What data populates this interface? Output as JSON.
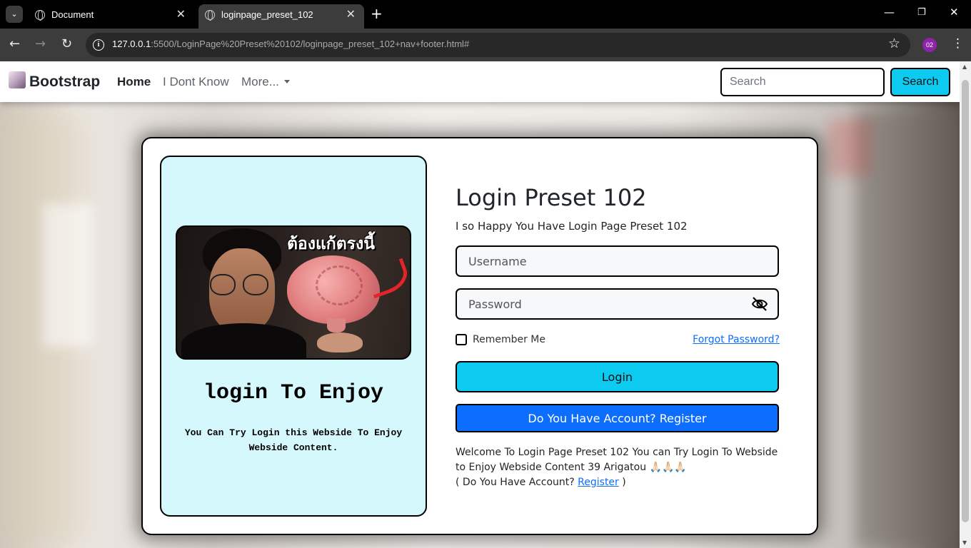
{
  "browser": {
    "tabs": [
      {
        "title": "Document"
      },
      {
        "title": "loginpage_preset_102"
      }
    ],
    "url_host": "127.0.0.1",
    "url_rest": ":5500/LoginPage%20Preset%20102/loginpage_preset_102+nav+footer.html#",
    "profile_initials": "02"
  },
  "navbar": {
    "brand": "Bootstrap",
    "links": [
      "Home",
      "I Dont Know",
      "More..."
    ],
    "search_placeholder": "Search",
    "search_button": "Search"
  },
  "left_panel": {
    "image_caption": "ต้องแก้ตรงนี้",
    "title": "login To Enjoy",
    "subtitle": "You Can Try Login this Webside To Enjoy Webside Content."
  },
  "form": {
    "title": "Login Preset 102",
    "subtitle": "I so Happy You Have Login Page Preset 102",
    "username_placeholder": "Username",
    "password_placeholder": "Password",
    "remember_label": "Remember Me",
    "forgot_link": "Forgot Password?",
    "login_button": "Login",
    "register_button": "Do You Have Account? Register",
    "welcome_text": "Welcome To Login Page Preset 102 You can Try Login To Webside to Enjoy Webside Content 39 Arigatou 🙏🏻🙏🏻🙏🏻",
    "account_prefix": "( Do You Have Account?",
    "account_link": "Register",
    "account_suffix": ")"
  },
  "colors": {
    "accent_cyan": "#0dcaf0",
    "accent_blue": "#0d6efd",
    "panel_bg": "#d5f8fc"
  }
}
